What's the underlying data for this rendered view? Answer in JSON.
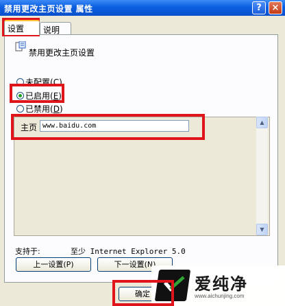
{
  "window": {
    "title": "禁用更改主页设置 属性",
    "help_label": "?",
    "close_label": "×"
  },
  "tabs": [
    {
      "label": "设置"
    },
    {
      "label": "说明"
    }
  ],
  "setting": {
    "name": "禁用更改主页设置"
  },
  "options": [
    {
      "label": "未配置",
      "key": "C",
      "checked": false
    },
    {
      "label": "已启用",
      "key": "E",
      "checked": true
    },
    {
      "label": "已禁用",
      "key": "D",
      "checked": false
    }
  ],
  "home": {
    "label": "主页",
    "value": "www.baidu.com"
  },
  "supports": {
    "label": "支持于:",
    "value": "至少 Internet Explorer 5.0"
  },
  "buttons": {
    "prev": "上一设置(P)",
    "next": "下一设置(N)",
    "ok": "确定"
  },
  "watermark": {
    "text": "爱纯净",
    "url": "www.aichunjing.com"
  },
  "colors": {
    "highlight": "#e0151b",
    "title_bar": "#0b5fe0",
    "dialog_bg": "#ece9d8"
  }
}
